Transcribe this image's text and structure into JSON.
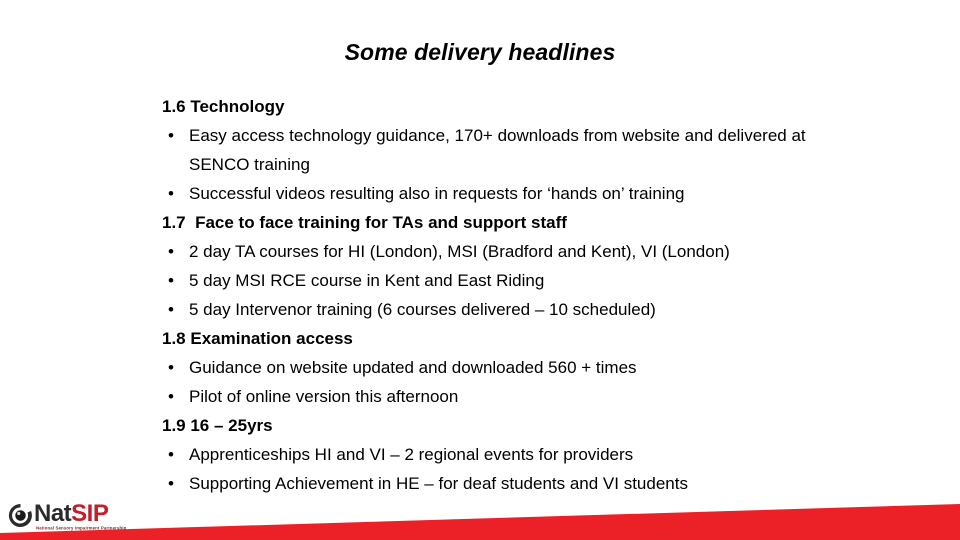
{
  "slide": {
    "title": "Some delivery headlines",
    "background_color": "#FFFFFF",
    "text_color": "#000000"
  },
  "content": {
    "blocks": [
      {
        "type": "heading",
        "text": "1.6 Technology"
      },
      {
        "type": "bullet",
        "marker": "•",
        "text": "Easy access technology guidance, 170+  downloads from website and delivered at SENCO training"
      },
      {
        "type": "bullet",
        "marker": "•",
        "text": "Successful videos resulting also in requests for ‘hands on’ training"
      },
      {
        "type": "heading",
        "text": "1.7  Face to face training for TAs and support staff"
      },
      {
        "type": "bullet",
        "marker": "•",
        "text": "2 day TA courses for HI (London), MSI (Bradford and Kent), VI  (London)"
      },
      {
        "type": "bullet",
        "marker": "•",
        "text": "5 day MSI RCE course in Kent and East Riding"
      },
      {
        "type": "bullet",
        "marker": "•",
        "text": "5 day Intervenor training (6 courses delivered – 10 scheduled)"
      },
      {
        "type": "heading",
        "text": "1.8 Examination access"
      },
      {
        "type": "bullet",
        "marker": "•",
        "text": "Guidance on website updated and downloaded 560 + times"
      },
      {
        "type": "bullet",
        "marker": "•",
        "text": "Pilot of online version this afternoon"
      },
      {
        "type": "heading",
        "text": "1.9 16 – 25yrs"
      },
      {
        "type": "bullet",
        "marker": "•",
        "text": "Apprenticeships HI and VI – 2 regional events for providers"
      },
      {
        "type": "bullet",
        "marker": "•",
        "text": "Supporting Achievement in HE – for deaf students and VI students"
      }
    ]
  },
  "logo": {
    "name_part1": "Nat",
    "name_part2": "SIP",
    "tagline": "National Sensory Impairment Partnership",
    "mark_icon": "circle-dot-icon",
    "dark_color": "#2B2B2B",
    "red_color": "#C0202B"
  },
  "decoration": {
    "banner_name": "red-wedge-banner",
    "banner_color": "#EC2027",
    "banner_color_dark": "#D8161D"
  }
}
